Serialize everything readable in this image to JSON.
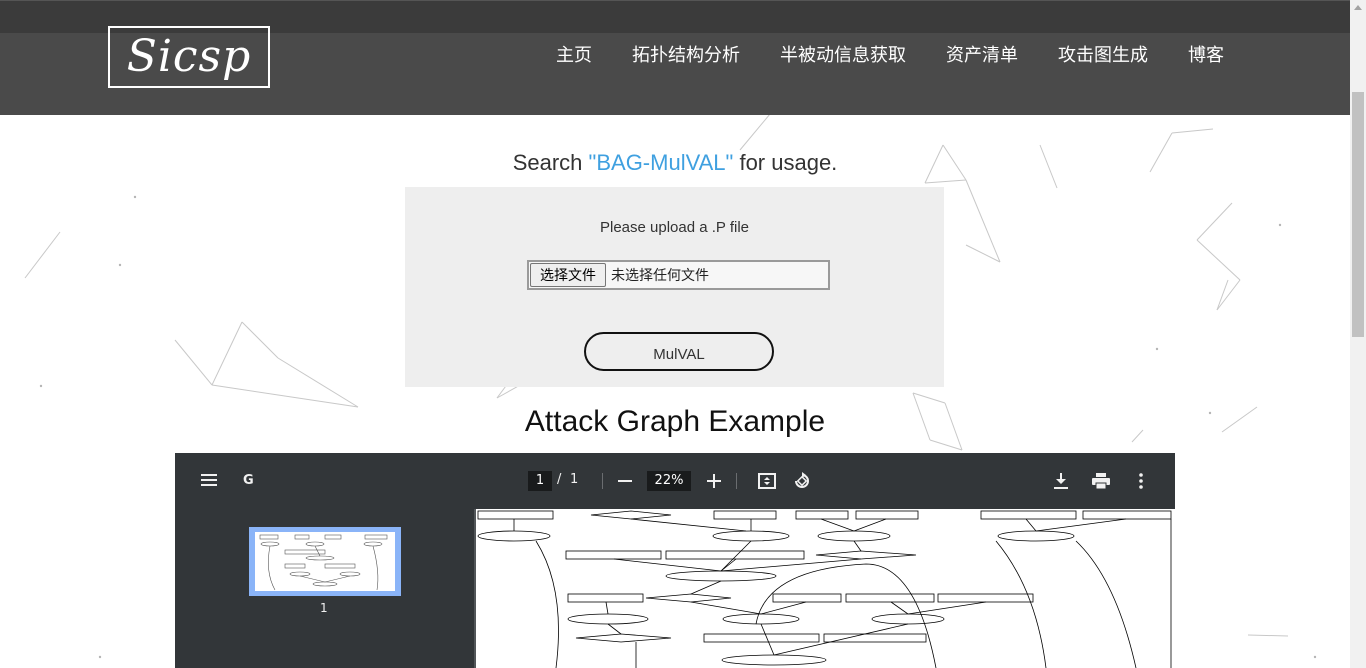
{
  "brand": {
    "logo_text": "Sicsp"
  },
  "nav": {
    "items": [
      {
        "label": "主页"
      },
      {
        "label": "拓扑结构分析"
      },
      {
        "label": "半被动信息获取"
      },
      {
        "label": "资产清单"
      },
      {
        "label": "攻击图生成"
      },
      {
        "label": "博客"
      }
    ]
  },
  "search": {
    "prefix": "Search ",
    "keyword": "\"BAG-MulVAL\"",
    "suffix": " for usage."
  },
  "upload": {
    "label": "Please upload a .P file",
    "file_button": "选择文件",
    "file_status": "未选择任何文件",
    "submit_label": "MulVAL"
  },
  "example": {
    "title": "Attack Graph Example"
  },
  "pdf_viewer": {
    "doc_title": "G",
    "page_current": "1",
    "page_separator": "/",
    "page_total": "1",
    "zoom": "22%",
    "thumbnail_label": "1",
    "icons": [
      "menu-icon",
      "zoom-out-icon",
      "zoom-in-icon",
      "fit-page-icon",
      "rotate-icon",
      "download-icon",
      "print-icon",
      "more-vert-icon"
    ]
  },
  "colors": {
    "header_bg": "#4a4a4a",
    "topbar_bg": "#3b3b3b",
    "keyword": "#3fa0e0",
    "upload_box_bg": "#eeeeee",
    "pdf_toolbar_bg": "#323639",
    "pdf_thumb_highlight": "#8ab4f8"
  }
}
